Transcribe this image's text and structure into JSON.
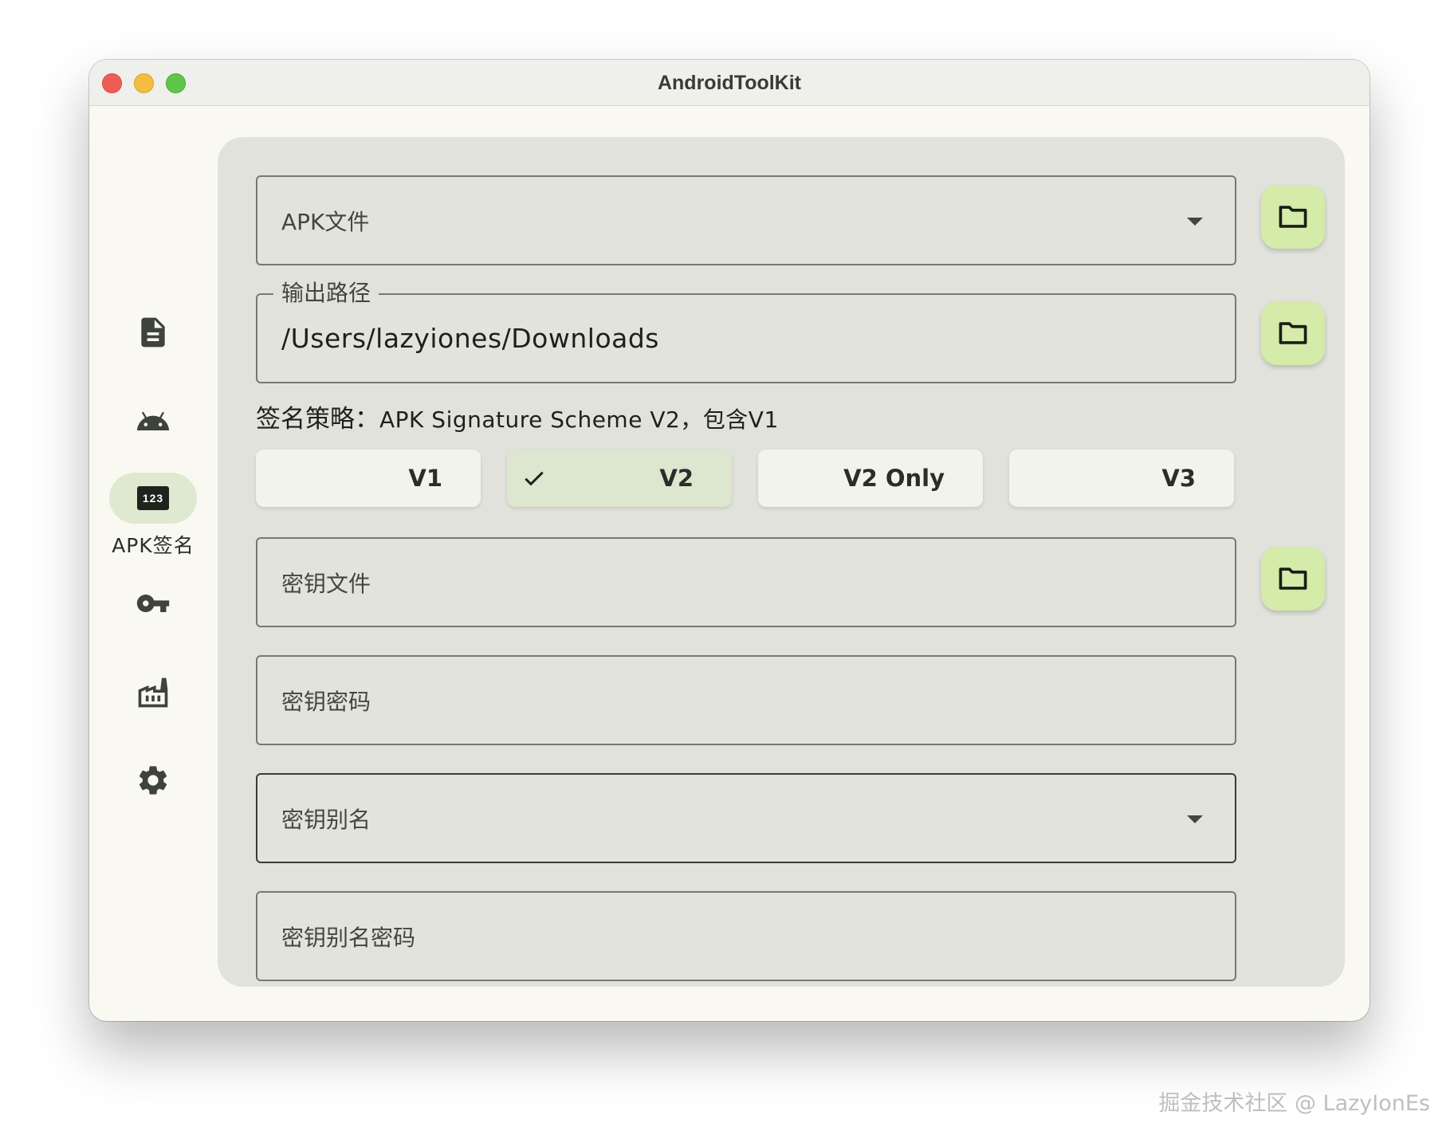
{
  "window": {
    "title": "AndroidToolKit"
  },
  "nav": {
    "items": [
      {
        "icon": "document-icon"
      },
      {
        "icon": "android-icon"
      },
      {
        "icon": "number-123-icon",
        "label": "APK签名",
        "active": true
      },
      {
        "icon": "key-icon"
      },
      {
        "icon": "factory-icon"
      },
      {
        "icon": "gear-icon"
      }
    ]
  },
  "form": {
    "apk_file": {
      "placeholder": "APK文件"
    },
    "output_path": {
      "label": "输出路径",
      "value": "/Users/lazyiones/Downloads"
    },
    "strategy": {
      "label": "签名策略：",
      "value": "APK Signature Scheme V2，包含V1"
    },
    "schemes": [
      {
        "label": "V1",
        "selected": false
      },
      {
        "label": "V2",
        "selected": true
      },
      {
        "label": "V2 Only",
        "selected": false
      },
      {
        "label": "V3",
        "selected": false
      }
    ],
    "key_file": {
      "placeholder": "密钥文件"
    },
    "key_password": {
      "placeholder": "密钥密码"
    },
    "key_alias": {
      "placeholder": "密钥别名"
    },
    "key_alias_password": {
      "placeholder": "密钥别名密码"
    }
  },
  "colors": {
    "window_bg": "#f9f9f2",
    "panel_bg": "#e2e2dc",
    "accent_button": "#d4eba9",
    "selected_segment": "#dde6cf",
    "active_nav_pill": "#dfe9cf"
  },
  "watermark": "掘金技术社区 @ LazyIonEs"
}
